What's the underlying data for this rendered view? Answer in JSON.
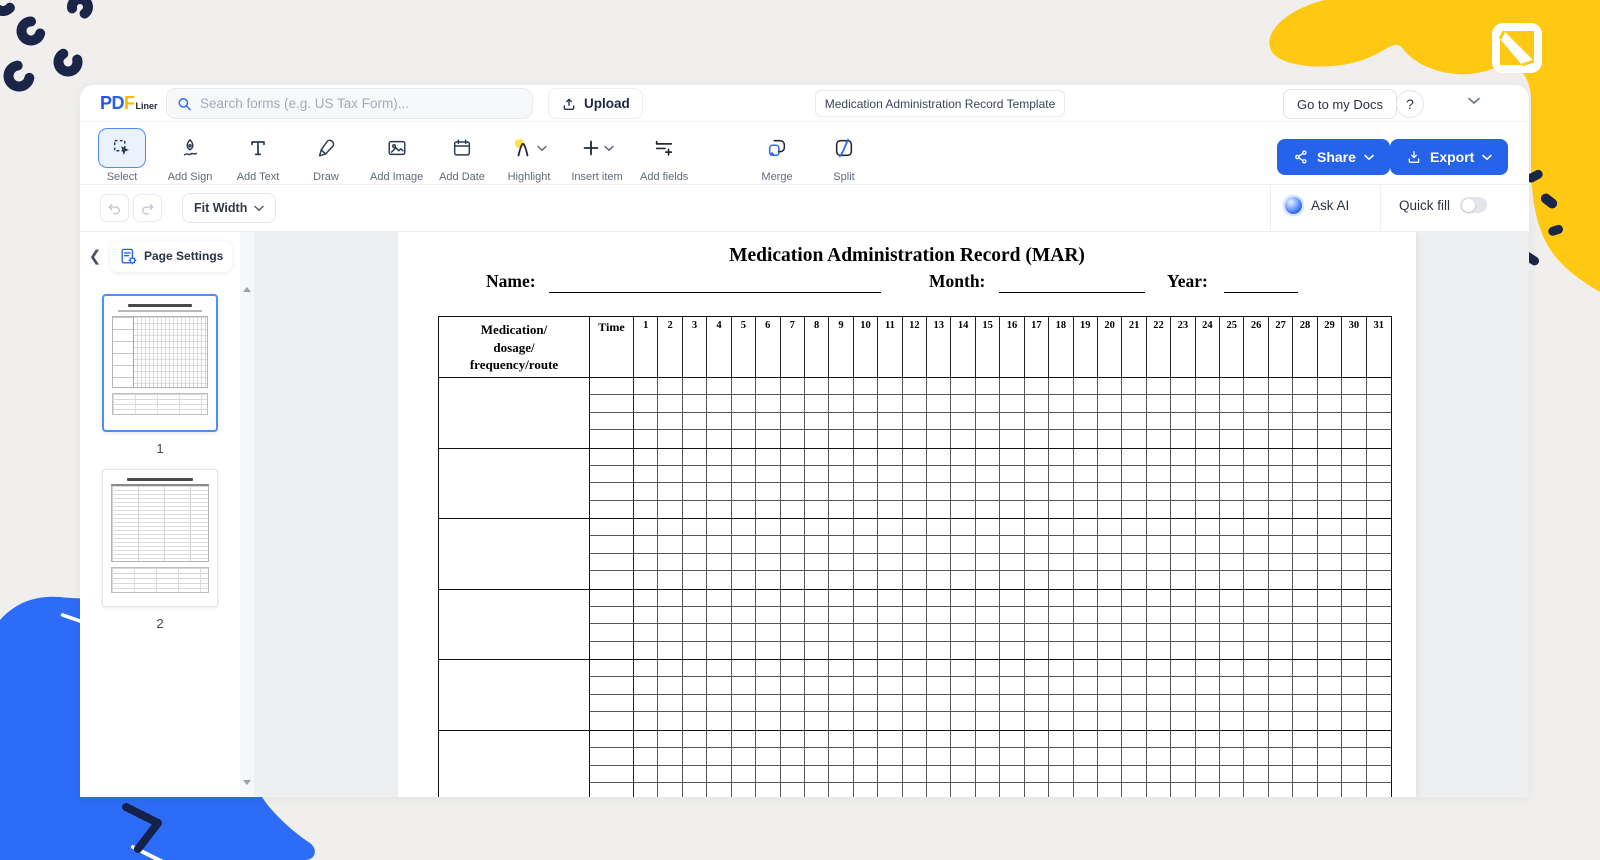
{
  "topbar": {
    "logo_pdf": "PDF",
    "logo_liner": "Liner",
    "search_placeholder": "Search forms (e.g. US Tax Form)...",
    "upload_label": "Upload",
    "doc_title": "Medication Administration Record Template",
    "goto_docs_label": "Go to my Docs",
    "help_label": "?"
  },
  "toolbar": {
    "tools": [
      {
        "label": "Select",
        "active": true
      },
      {
        "label": "Add Sign"
      },
      {
        "label": "Add Text"
      },
      {
        "label": "Draw"
      },
      {
        "label": "Add Image"
      },
      {
        "label": "Add Date"
      },
      {
        "label": "Highlight",
        "dropdown": true
      },
      {
        "label": "Insert item",
        "dropdown": true
      },
      {
        "label": "Add fields"
      },
      {
        "label": "Merge"
      },
      {
        "label": "Split"
      }
    ],
    "share_label": "Share",
    "export_label": "Export"
  },
  "subtoolbar": {
    "zoom_label": "Fit Width",
    "ask_ai_label": "Ask AI",
    "quick_fill_label": "Quick fill",
    "quick_fill_on": false
  },
  "sidebar": {
    "page_settings_label": "Page Settings",
    "pages": [
      {
        "number": "1",
        "selected": true
      },
      {
        "number": "2",
        "selected": false
      }
    ]
  },
  "document": {
    "title": "Medication Administration Record (MAR)",
    "name_label": "Name:",
    "month_label": "Month:",
    "year_label": "Year:",
    "table": {
      "med_header_lines": [
        "Medication/",
        "dosage/",
        "frequency/route"
      ],
      "time_header": "Time",
      "days": [
        "1",
        "2",
        "3",
        "4",
        "5",
        "6",
        "7",
        "8",
        "9",
        "10",
        "11",
        "12",
        "13",
        "14",
        "15",
        "16",
        "17",
        "18",
        "19",
        "20",
        "21",
        "22",
        "23",
        "24",
        "25",
        "26",
        "27",
        "28",
        "29",
        "30",
        "31"
      ],
      "medication_blocks": 6,
      "rows_per_block": 4
    }
  },
  "colors": {
    "accent_blue": "#2563eb",
    "brand_yellow": "#ffc913",
    "decor_navy": "#1b2547",
    "decor_blue_blob": "#2d6cf6",
    "active_tool_bg": "#eaf2fe"
  }
}
